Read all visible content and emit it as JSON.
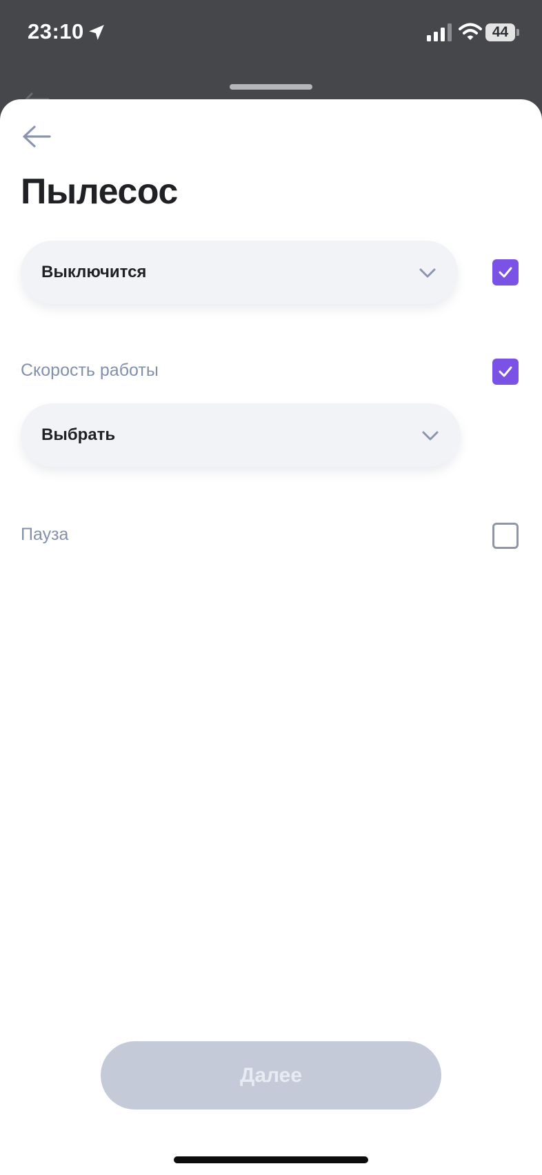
{
  "status_bar": {
    "time": "23:10",
    "battery": "44",
    "icons": [
      "location-arrow-icon",
      "cellular-signal-icon",
      "wifi-icon",
      "battery-icon"
    ]
  },
  "screen": {
    "title": "Пылесос",
    "back_icon": "arrow-left-icon"
  },
  "state_select": {
    "value": "Выключится",
    "checked": true
  },
  "speed": {
    "label": "Скорость работы",
    "value": "Выбрать",
    "checked": true
  },
  "pause": {
    "label": "Пауза",
    "checked": false
  },
  "next_button": {
    "label": "Далее",
    "enabled": false
  },
  "colors": {
    "accent": "#7b52e6",
    "label": "#8390ab",
    "disabled_button": "#c4cad8",
    "select_bg": "#f1f3f6"
  }
}
